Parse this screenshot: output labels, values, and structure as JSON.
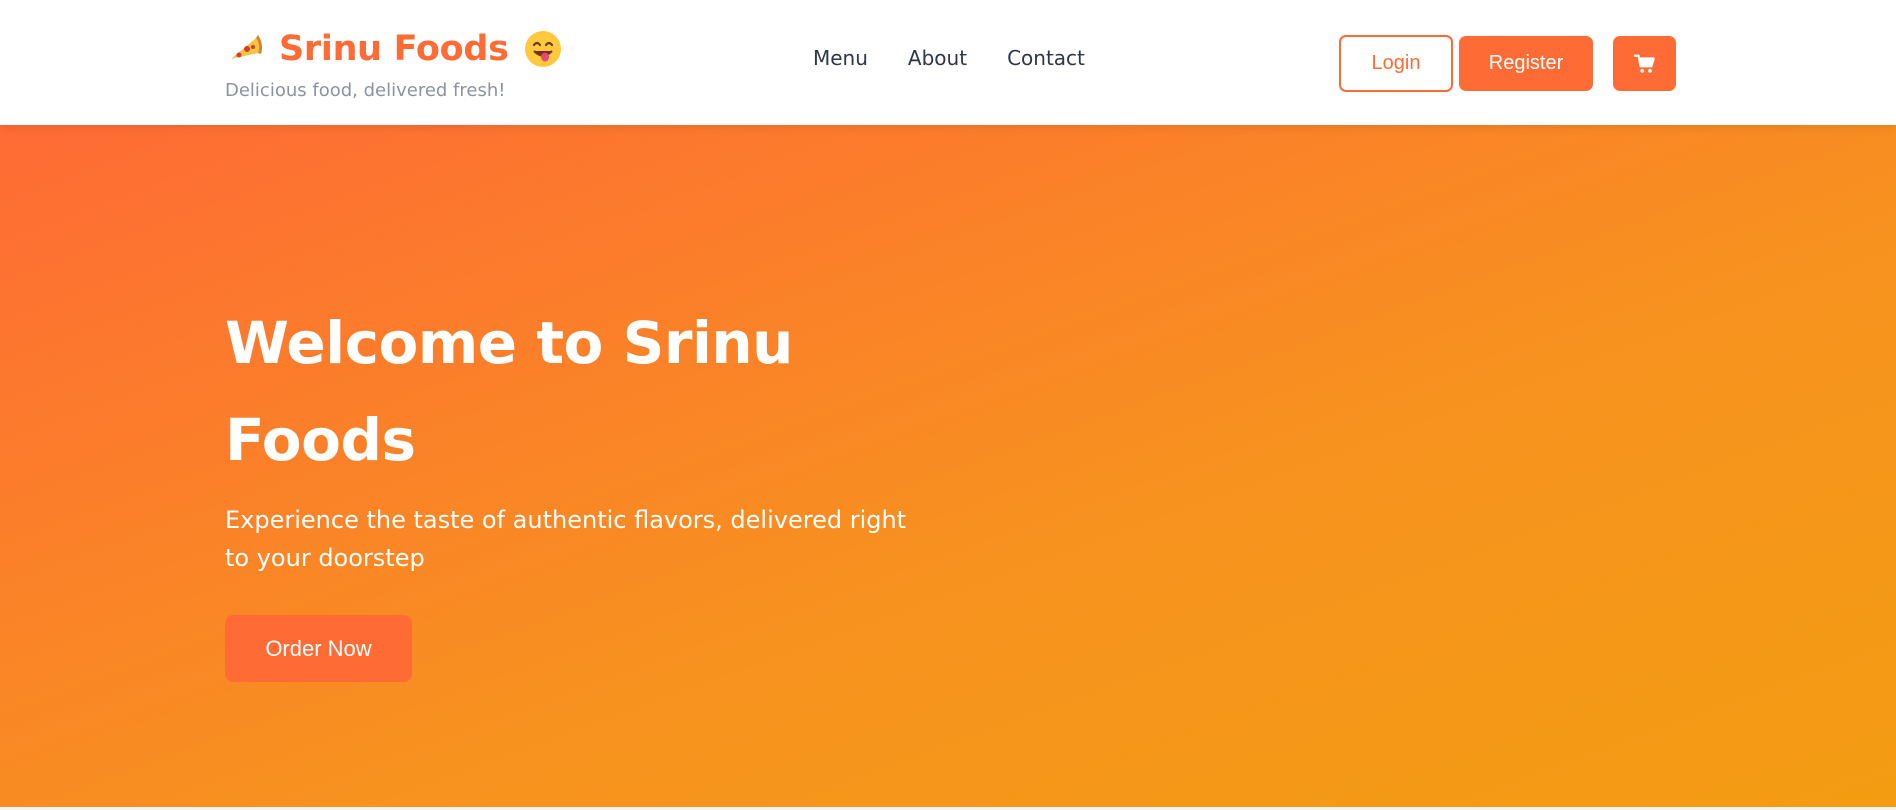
{
  "header": {
    "brand_name": "Srinu Foods",
    "tagline": "Delicious food, delivered fresh!",
    "icons": [
      "pizza-icon",
      "face-savoring-food-icon",
      "cart-icon"
    ]
  },
  "nav": {
    "items": [
      {
        "label": "Menu"
      },
      {
        "label": "About"
      },
      {
        "label": "Contact"
      }
    ]
  },
  "actions": {
    "login_label": "Login",
    "register_label": "Register"
  },
  "hero": {
    "title": "Welcome to Srinu Foods",
    "subtitle": "Experience the taste of authentic flavors, delivered right to your doorstep",
    "cta_label": "Order Now"
  },
  "colors": {
    "accent": "#ff6b35",
    "gradient_start": "#ff6b35",
    "gradient_end": "#f39c12",
    "nav_text": "#2d3748",
    "tagline_text": "#8a94a0"
  }
}
